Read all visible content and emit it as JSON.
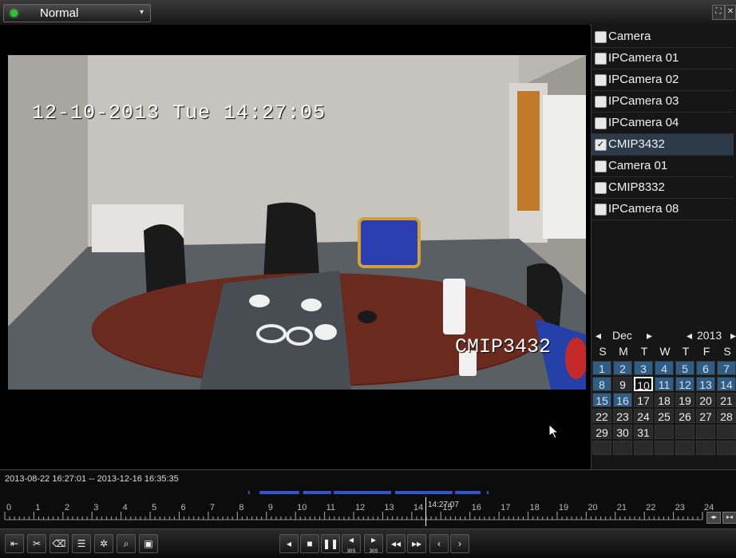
{
  "header": {
    "mode_label": "Normal",
    "mode_icon": "status-dot-icon",
    "dropdown_icon": "chevron-down-icon",
    "window_buttons": [
      "fullscreen-icon",
      "close-icon"
    ]
  },
  "video": {
    "osd_datetime": "12-10-2013 Tue 14:27:05",
    "osd_camera": "CMIP3432"
  },
  "camera_list": {
    "header": "Camera",
    "items": [
      {
        "name": "IPCamera 01",
        "checked": false
      },
      {
        "name": "IPCamera 02",
        "checked": false
      },
      {
        "name": "IPCamera 03",
        "checked": false
      },
      {
        "name": "IPCamera 04",
        "checked": false
      },
      {
        "name": "CMIP3432",
        "checked": true
      },
      {
        "name": "Camera 01",
        "checked": false
      },
      {
        "name": "CMIP8332",
        "checked": false
      },
      {
        "name": "IPCamera 08",
        "checked": false
      }
    ]
  },
  "calendar": {
    "month": "Dec",
    "year": "2013",
    "weekdays": [
      "S",
      "M",
      "T",
      "W",
      "T",
      "F",
      "S"
    ],
    "selected_day": "10",
    "weeks": [
      [
        "1",
        "2",
        "3",
        "4",
        "5",
        "6",
        "7"
      ],
      [
        "8",
        "9",
        "10",
        "11",
        "12",
        "13",
        "14"
      ],
      [
        "15",
        "16",
        "17",
        "18",
        "19",
        "20",
        "21"
      ],
      [
        "22",
        "23",
        "24",
        "25",
        "26",
        "27",
        "28"
      ],
      [
        "29",
        "30",
        "31",
        "",
        "",
        "",
        ""
      ],
      [
        "",
        "",
        "",
        "",
        "",
        "",
        ""
      ]
    ],
    "recorded_days": [
      "1",
      "2",
      "3",
      "4",
      "5",
      "6",
      "7",
      "8",
      "11",
      "12",
      "13",
      "14",
      "15",
      "16"
    ]
  },
  "timeline": {
    "range": "2013-08-22 16:27:01 -- 2013-12-16 16:35:35",
    "hours": [
      "0",
      "1",
      "2",
      "3",
      "4",
      "5",
      "6",
      "7",
      "8",
      "9",
      "10",
      "11",
      "12",
      "13",
      "14",
      "15",
      "16",
      "17",
      "18",
      "19",
      "20",
      "21",
      "22",
      "23",
      "24"
    ],
    "cursor_time": "14:27:07",
    "colors": {
      "record": "#3355cc",
      "cursor": "#ffffff"
    }
  },
  "toolbar": {
    "left_buttons": [
      "add-tag-icon",
      "clip-icon",
      "custom-tag-icon",
      "tag-manage-icon",
      "settings-icon",
      "digital-zoom-icon",
      "snapshot-icon"
    ],
    "playback_buttons": [
      "reverse-play-icon",
      "stop-icon",
      "pause-icon",
      "back-30s-icon",
      "forward-30s-icon",
      "slow-icon",
      "fast-icon",
      "prev-day-icon",
      "next-day-icon"
    ],
    "back_30s_caption": "30S",
    "fwd_30s_caption": "30S"
  }
}
